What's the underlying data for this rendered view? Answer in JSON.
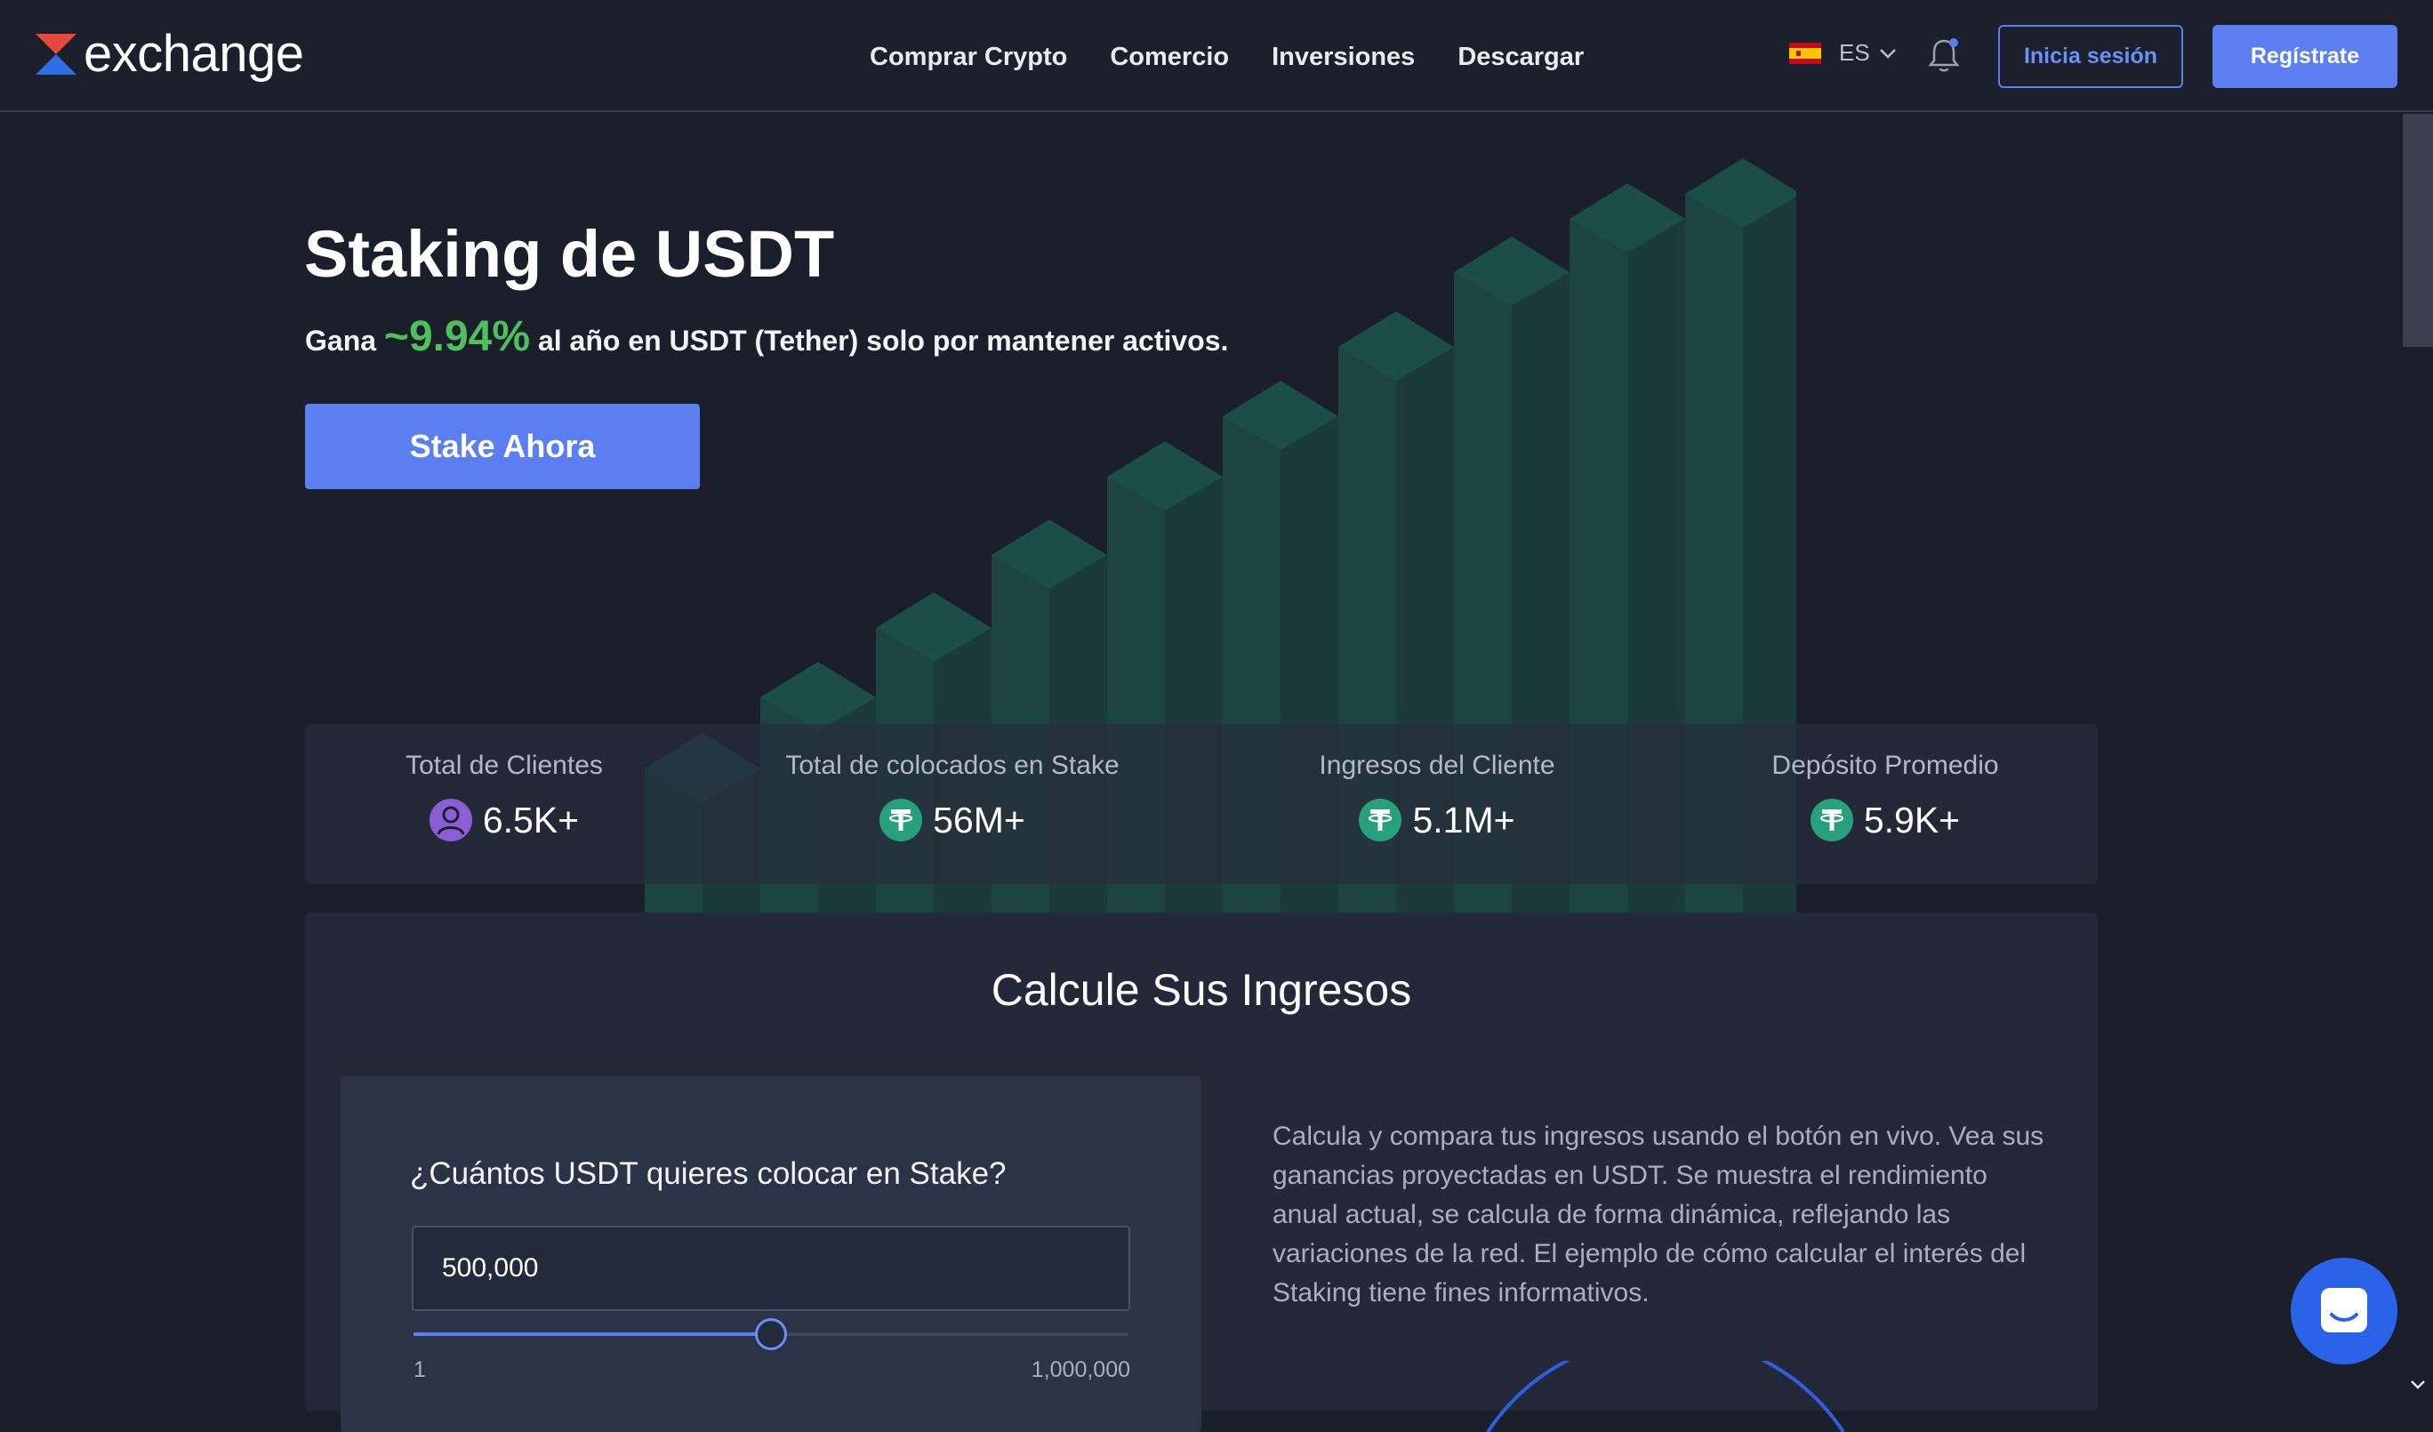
{
  "header": {
    "logo_text": "exchange",
    "nav": [
      "Comprar Crypto",
      "Comercio",
      "Inversiones",
      "Descargar"
    ],
    "language": "ES",
    "login_label": "Inicia sesión",
    "register_label": "Regístrate"
  },
  "hero": {
    "title": "Staking de USDT",
    "sub_prefix": "Gana",
    "rate": "~9.94%",
    "sub_suffix": "al año en USDT (Tether) solo por mantener activos.",
    "cta": "Stake Ahora"
  },
  "stats": [
    {
      "label": "Total de Clientes",
      "value": "6.5K+",
      "icon": "user-icon"
    },
    {
      "label": "Total de colocados en Stake",
      "value": "56M+",
      "icon": "tether-icon"
    },
    {
      "label": "Ingresos del Cliente",
      "value": "5.1M+",
      "icon": "tether-icon"
    },
    {
      "label": "Depósito Promedio",
      "value": "5.9K+",
      "icon": "tether-icon"
    }
  ],
  "calculator": {
    "title": "Calcule Sus Ingresos",
    "question": "¿Cuántos USDT quieres colocar en Stake?",
    "amount": "500,000",
    "slider_min": "1",
    "slider_max": "1,000,000",
    "slider_level": 0.5,
    "description": "Calcula y compara tus ingresos usando el botón en vivo. Vea sus ganancias proyectadas en USDT. Se muestra el rendimiento anual actual, se calcula de forma dinámica, reflejando las variaciones de la red. El ejemplo de cómo calcular el interés del Staking tiene fines informativos."
  },
  "colors": {
    "accent": "#5b7ff0",
    "rate_green": "#4dc25c",
    "bar_green": "#1f9c78",
    "tether_green": "#26a17b",
    "background": "#1a1f2b"
  }
}
